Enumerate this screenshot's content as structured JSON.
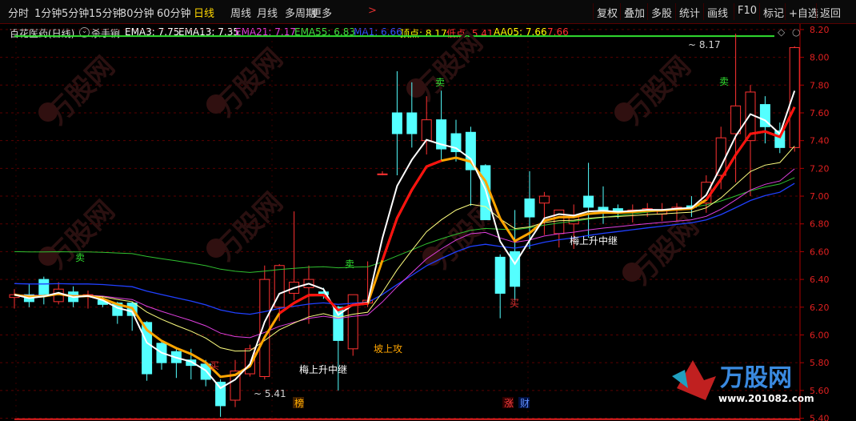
{
  "toolbar": {
    "periods": [
      "分时",
      "1分钟",
      "5分钟",
      "15分钟",
      "30分钟",
      "60分钟",
      "日线",
      "周线",
      "月线",
      "多周期",
      "更多"
    ],
    "active_period": "日线",
    "more_arrow": ">",
    "right_buttons": [
      "复权",
      "叠加",
      "多股",
      "统计",
      "画线",
      "F10",
      "标记",
      "+自选",
      "返回"
    ]
  },
  "indicator_bar": {
    "stock": "百花医药(日线)",
    "formula": "杀手锏",
    "items": [
      {
        "label": "EMA3: 7.75",
        "color": "#ffffff"
      },
      {
        "label": "EMA13: 7.35",
        "color": "#ffffff"
      },
      {
        "label": "EMA21: 7.17",
        "color": "#e040e0"
      },
      {
        "label": "EMA55: 6.83",
        "color": "#40e040"
      },
      {
        "label": "MA1: 6.66",
        "color": "#3050ff"
      },
      {
        "label": "顶点: 8.17",
        "color": "#ffff00"
      },
      {
        "label": "低点: 5.41",
        "color": "#ff3030"
      },
      {
        "label": "AA05: 7.66",
        "color": "#ffff00"
      },
      {
        "label": "7.66",
        "color": "#ff3030"
      }
    ]
  },
  "annotations": {
    "high_label": "8.17",
    "low_label": "5.41",
    "sell": "卖",
    "buy": "买",
    "text_meishang": "梅上升中继",
    "text_poshanggong": "坡上攻",
    "badge_bang": "榜",
    "badge_zhang": "涨",
    "badge_cai": "财"
  },
  "watermark": {
    "brand": "万股网",
    "url": "www.201082.com"
  },
  "chart_data": {
    "type": "candlestick",
    "title": "百花医药(日线)",
    "ylim": [
      5.38,
      8.24
    ],
    "y_ticks": [
      5.4,
      5.6,
      5.8,
      6.0,
      6.2,
      6.4,
      6.6,
      6.8,
      7.0,
      7.2,
      7.4,
      7.6,
      7.8,
      8.0,
      8.2
    ],
    "candles": [
      {
        "o": 6.27,
        "h": 6.33,
        "l": 6.19,
        "c": 6.29
      },
      {
        "o": 6.29,
        "h": 6.37,
        "l": 6.2,
        "c": 6.24
      },
      {
        "o": 6.4,
        "h": 6.42,
        "l": 6.22,
        "c": 6.29
      },
      {
        "o": 6.24,
        "h": 6.38,
        "l": 6.22,
        "c": 6.33
      },
      {
        "o": 6.31,
        "h": 6.35,
        "l": 6.2,
        "c": 6.24
      },
      {
        "o": 6.29,
        "h": 6.32,
        "l": 6.19,
        "c": 6.29
      },
      {
        "o": 6.25,
        "h": 6.28,
        "l": 6.2,
        "c": 6.22
      },
      {
        "o": 6.23,
        "h": 6.24,
        "l": 6.08,
        "c": 6.14
      },
      {
        "o": 6.23,
        "h": 6.24,
        "l": 6.03,
        "c": 6.14
      },
      {
        "o": 6.09,
        "h": 6.1,
        "l": 5.67,
        "c": 5.72
      },
      {
        "o": 5.94,
        "h": 5.96,
        "l": 5.75,
        "c": 5.8
      },
      {
        "o": 5.88,
        "h": 5.9,
        "l": 5.69,
        "c": 5.8
      },
      {
        "o": 5.82,
        "h": 5.9,
        "l": 5.68,
        "c": 5.78
      },
      {
        "o": 5.79,
        "h": 5.82,
        "l": 5.63,
        "c": 5.68
      },
      {
        "o": 5.66,
        "h": 5.68,
        "l": 5.41,
        "c": 5.49
      },
      {
        "o": 5.53,
        "h": 5.82,
        "l": 5.48,
        "c": 5.74
      },
      {
        "o": 5.72,
        "h": 5.93,
        "l": 5.7,
        "c": 5.9
      },
      {
        "o": 5.7,
        "h": 6.5,
        "l": 5.68,
        "c": 6.4
      },
      {
        "o": 6.2,
        "h": 6.51,
        "l": 6.1,
        "c": 6.5
      },
      {
        "o": 6.3,
        "h": 6.89,
        "l": 6.25,
        "c": 6.38
      },
      {
        "o": 6.34,
        "h": 6.5,
        "l": 6.08,
        "c": 6.4
      },
      {
        "o": 6.31,
        "h": 6.34,
        "l": 6.26,
        "c": 6.29
      },
      {
        "o": 6.2,
        "h": 6.21,
        "l": 5.6,
        "c": 5.96
      },
      {
        "o": 5.9,
        "h": 6.27,
        "l": 5.85,
        "c": 6.29
      },
      {
        "o": 6.23,
        "h": 6.53,
        "l": 6.2,
        "c": 6.25
      },
      {
        "o": 7.16,
        "h": 7.18,
        "l": 7.15,
        "c": 7.16
      },
      {
        "o": 7.6,
        "h": 7.9,
        "l": 7.15,
        "c": 7.45
      },
      {
        "o": 7.6,
        "h": 7.82,
        "l": 7.35,
        "c": 7.45
      },
      {
        "o": 7.4,
        "h": 7.72,
        "l": 7.3,
        "c": 7.55
      },
      {
        "o": 7.55,
        "h": 7.76,
        "l": 7.25,
        "c": 7.34
      },
      {
        "o": 7.45,
        "h": 7.55,
        "l": 7.25,
        "c": 7.32
      },
      {
        "o": 7.46,
        "h": 7.5,
        "l": 6.93,
        "c": 7.19
      },
      {
        "o": 7.22,
        "h": 7.23,
        "l": 6.98,
        "c": 6.83
      },
      {
        "o": 6.56,
        "h": 6.58,
        "l": 6.12,
        "c": 6.3
      },
      {
        "o": 6.6,
        "h": 6.9,
        "l": 6.25,
        "c": 6.35
      },
      {
        "o": 6.98,
        "h": 7.18,
        "l": 6.62,
        "c": 6.85
      },
      {
        "o": 6.95,
        "h": 7.03,
        "l": 6.72,
        "c": 7.0
      },
      {
        "o": 6.73,
        "h": 6.84,
        "l": 6.63,
        "c": 6.9
      },
      {
        "o": 6.8,
        "h": 6.94,
        "l": 6.62,
        "c": 6.85
      },
      {
        "o": 7.0,
        "h": 7.24,
        "l": 6.7,
        "c": 6.92
      },
      {
        "o": 6.92,
        "h": 7.07,
        "l": 6.8,
        "c": 6.9
      },
      {
        "o": 6.91,
        "h": 6.94,
        "l": 6.84,
        "c": 6.88
      },
      {
        "o": 6.89,
        "h": 6.94,
        "l": 6.81,
        "c": 6.9
      },
      {
        "o": 6.9,
        "h": 6.95,
        "l": 6.85,
        "c": 6.91
      },
      {
        "o": 6.87,
        "h": 6.95,
        "l": 6.82,
        "c": 6.9
      },
      {
        "o": 6.9,
        "h": 6.95,
        "l": 6.82,
        "c": 6.92
      },
      {
        "o": 6.93,
        "h": 7.0,
        "l": 6.85,
        "c": 6.92
      },
      {
        "o": 6.95,
        "h": 7.15,
        "l": 6.88,
        "c": 7.1
      },
      {
        "o": 7.15,
        "h": 7.5,
        "l": 7.05,
        "c": 7.42
      },
      {
        "o": 7.45,
        "h": 8.17,
        "l": 7.1,
        "c": 7.65
      },
      {
        "o": 7.4,
        "h": 7.8,
        "l": 7.0,
        "c": 7.75
      },
      {
        "o": 7.66,
        "h": 7.72,
        "l": 7.38,
        "c": 7.5
      },
      {
        "o": 7.47,
        "h": 7.53,
        "l": 7.31,
        "c": 7.35
      },
      {
        "o": 7.35,
        "h": 8.08,
        "l": 7.32,
        "c": 8.07
      }
    ],
    "series": [
      {
        "name": "EMA3",
        "color": "#ffffff"
      },
      {
        "name": "EMA13",
        "color": "#ffff80"
      },
      {
        "name": "EMA21",
        "color": "#e040e0"
      },
      {
        "name": "EMA55",
        "color": "#40e040"
      },
      {
        "name": "MA1",
        "color": "#3050ff"
      },
      {
        "name": "AA05",
        "color": "#ffa500"
      }
    ],
    "high": 8.17,
    "low": 5.41
  }
}
